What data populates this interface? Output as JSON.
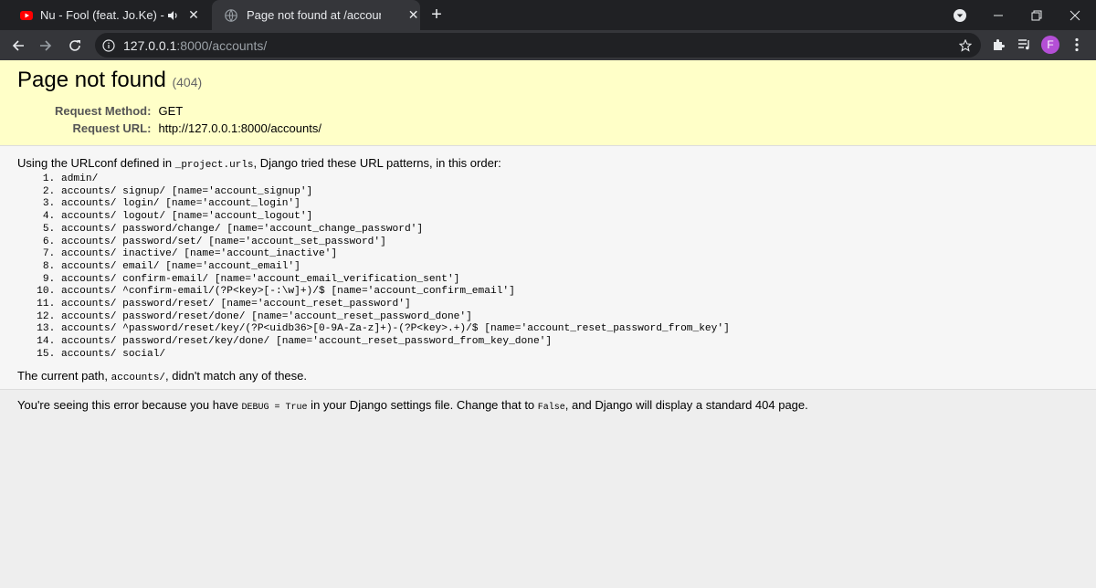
{
  "browser": {
    "tabs": [
      {
        "title": "Nu - Fool (feat. Jo.Ke) - YouTube",
        "favicon": "youtube-icon",
        "audio": true
      },
      {
        "title": "Page not found at /accounts/",
        "favicon": "globe-icon",
        "active": true
      }
    ],
    "address_host": "127.0.0.1",
    "address_rest": ":8000/accounts/",
    "profile_initial": "F"
  },
  "page": {
    "heading": "Page not found",
    "status": "(404)",
    "request_method_label": "Request Method:",
    "request_method": "GET",
    "request_url_label": "Request URL:",
    "request_url": "http://127.0.0.1:8000/accounts/",
    "urlconf_pre": "Using the URLconf defined in ",
    "urlconf_code": "_project.urls",
    "urlconf_post": ", Django tried these URL patterns, in this order:",
    "patterns": [
      "admin/",
      "accounts/ signup/ [name='account_signup']",
      "accounts/ login/ [name='account_login']",
      "accounts/ logout/ [name='account_logout']",
      "accounts/ password/change/ [name='account_change_password']",
      "accounts/ password/set/ [name='account_set_password']",
      "accounts/ inactive/ [name='account_inactive']",
      "accounts/ email/ [name='account_email']",
      "accounts/ confirm-email/ [name='account_email_verification_sent']",
      "accounts/ ^confirm-email/(?P<key>[-:\\w]+)/$ [name='account_confirm_email']",
      "accounts/ password/reset/ [name='account_reset_password']",
      "accounts/ password/reset/done/ [name='account_reset_password_done']",
      "accounts/ ^password/reset/key/(?P<uidb36>[0-9A-Za-z]+)-(?P<key>.+)/$ [name='account_reset_password_from_key']",
      "accounts/ password/reset/key/done/ [name='account_reset_password_from_key_done']",
      "accounts/ social/"
    ],
    "current_path_pre": "The current path, ",
    "current_path_code": "accounts/",
    "current_path_post": ", didn't match any of these.",
    "explanation_pre": "You're seeing this error because you have ",
    "explanation_code1": "DEBUG = True",
    "explanation_mid": " in your Django settings file. Change that to ",
    "explanation_code2": "False",
    "explanation_post": ", and Django will display a standard 404 page."
  }
}
